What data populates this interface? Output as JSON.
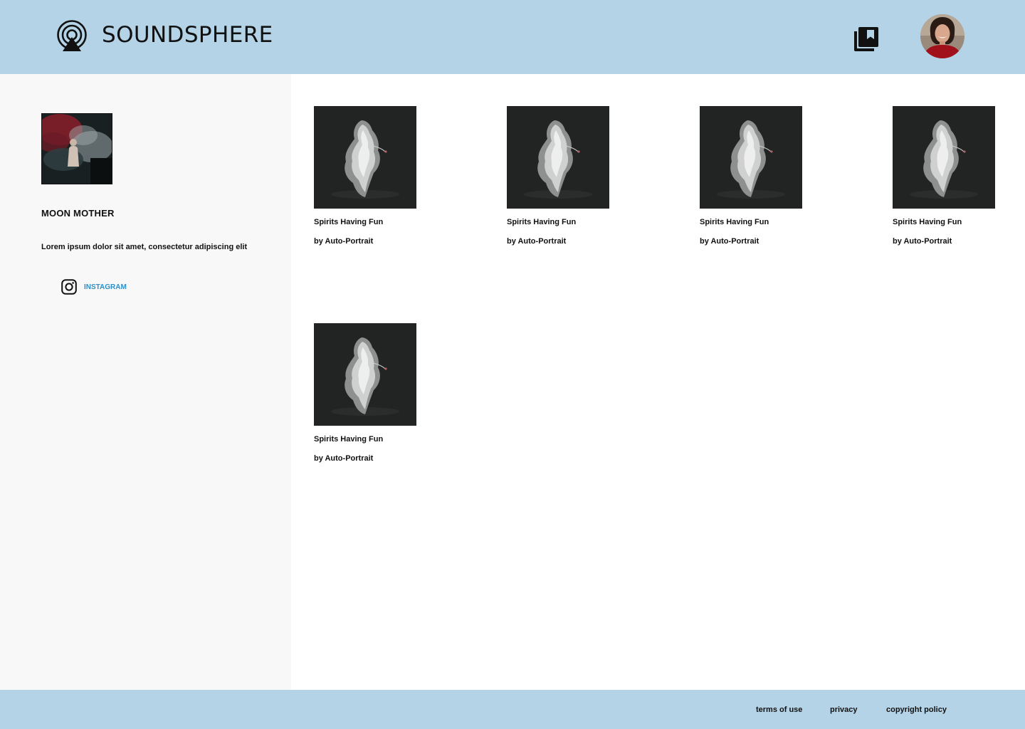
{
  "header": {
    "brand": "SOUNDSPHERE",
    "logo_icon": "broadcast-tower-icon",
    "library_icon": "library-collections-icon",
    "avatar_icon": "user-avatar"
  },
  "artist": {
    "name": "MOON MOTHER",
    "bio": "Lorem ipsum dolor sit amet, consectetur adipiscing elit",
    "social_label": "INSTAGRAM",
    "social_icon": "instagram-icon"
  },
  "albums": [
    {
      "title": "Spirits Having Fun",
      "artist": "by Auto-Portrait"
    },
    {
      "title": "Spirits Having Fun",
      "artist": "by Auto-Portrait"
    },
    {
      "title": "Spirits Having Fun",
      "artist": "by Auto-Portrait"
    },
    {
      "title": "Spirits Having Fun",
      "artist": "by Auto-Portrait"
    },
    {
      "title": "Spirits Having Fun",
      "artist": "by Auto-Portrait"
    }
  ],
  "footer": {
    "links": [
      "terms of use",
      "privacy",
      "copyright policy"
    ]
  },
  "colors": {
    "header_bg": "#b4d3e7",
    "sidebar_bg": "#f8f8f8",
    "link_accent": "#2d8fc8"
  }
}
